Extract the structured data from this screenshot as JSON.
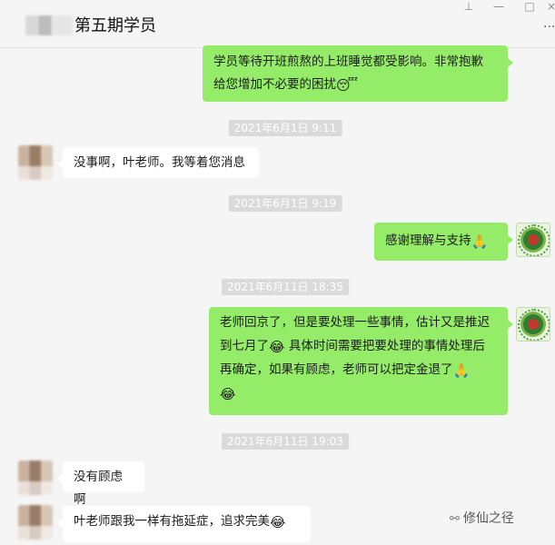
{
  "window": {
    "title": "第五期学员",
    "controls": {
      "pin": "⊥",
      "minimize": "—",
      "maximize": "□",
      "close": "×"
    },
    "more": "···"
  },
  "messages": [
    {
      "from": "me",
      "lines": [
        "学员等待开班煎熬的上班睡觉都受影响。非常抱歉",
        "给您增加不必要的困扰"
      ],
      "emoji": "😴"
    },
    {
      "type": "timestamp",
      "text": "2021年6月1日 9:11"
    },
    {
      "from": "other",
      "text": "没事啊，叶老师。我等着您消息"
    },
    {
      "type": "timestamp",
      "text": "2021年6月1日 9:19"
    },
    {
      "from": "me",
      "text": "感谢理解与支持",
      "emoji": "🙏"
    },
    {
      "type": "timestamp",
      "text": "2021年6月11日 18:35"
    },
    {
      "from": "me",
      "lines": [
        "老师回京了，但是要处理一些事情，估计又是推迟",
        "到七月了",
        "具体时间需要把要处理的事情处理后",
        "再确定，如果有顾虑，老师可以把定金退了"
      ],
      "emoji1": "😂",
      "emoji2": "🙏",
      "emoji3": "😂"
    },
    {
      "type": "timestamp",
      "text": "2021年6月11日 19:03"
    },
    {
      "from": "other",
      "text": "没有顾虑啊"
    },
    {
      "from": "other",
      "text": "叶老师跟我一样有拖延症，追求完美",
      "emoji": "😂"
    }
  ],
  "watermark": {
    "icon": "wechat-icon",
    "text": "修仙之径"
  }
}
